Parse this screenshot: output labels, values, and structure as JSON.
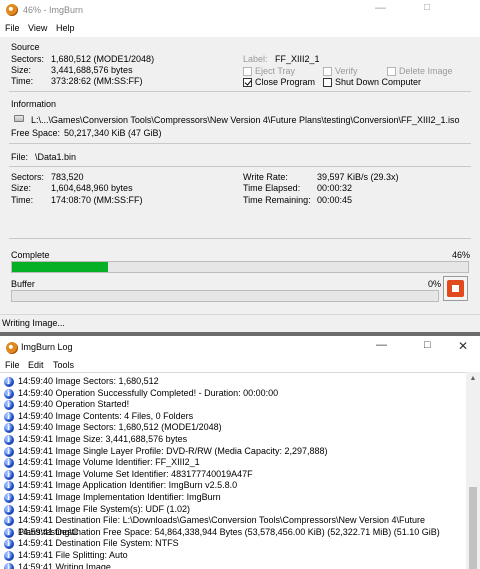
{
  "main_window": {
    "title": "46% - ImgBurn",
    "menu": [
      "File",
      "View",
      "Help"
    ],
    "source": {
      "group_title": "Source",
      "sectors_label": "Sectors:",
      "sectors_value": "1,680,512 (MODE1/2048)",
      "size_label": "Size:",
      "size_value": "3,441,688,576 bytes",
      "time_label": "Time:",
      "time_value": "373:28:62 (MM:SS:FF)",
      "label_label": "Label:",
      "label_value": "FF_XIII2_1",
      "eject_tray": "Eject Tray",
      "verify": "Verify",
      "delete_image": "Delete Image",
      "close_program": "Close Program",
      "shut_down": "Shut Down Computer"
    },
    "information": {
      "group_title": "Information",
      "path": "L:\\...\\Games\\Conversion Tools\\Compressors\\New Version 4\\Future Plans\\testing\\Conversion\\FF_XIII2_1.iso",
      "free_space_label": "Free Space:",
      "free_space_value": "50,217,340 KiB  (47 GiB)",
      "file_label": "File:",
      "file_value": "\\Data1.bin",
      "sectors_label": "Sectors:",
      "sectors_value": "783,520",
      "size_label": "Size:",
      "size_value": "1,604,648,960 bytes",
      "time_label": "Time:",
      "time_value": "174:08:70 (MM:SS:FF)",
      "write_rate_label": "Write Rate:",
      "write_rate_value": "39,597 KiB/s (29.3x)",
      "elapsed_label": "Time Elapsed:",
      "elapsed_value": "00:00:32",
      "remaining_label": "Time Remaining:",
      "remaining_value": "00:00:45"
    },
    "complete_label": "Complete",
    "complete_percent_text": "46%",
    "complete_fraction": 0.46,
    "buffer_label": "Buffer",
    "buffer_percent_text": "0%",
    "buffer_fraction": 0,
    "status": "Writing Image..."
  },
  "log_window": {
    "title": "ImgBurn Log",
    "menu": [
      "File",
      "Edit",
      "Tools"
    ],
    "entries": [
      "14:59:40 Image Sectors: 1,680,512",
      "14:59:40 Operation Successfully Completed! - Duration: 00:00:00",
      "14:59:40 Operation Started!",
      "14:59:40 Image Contents: 4 Files, 0 Folders",
      "14:59:40 Image Sectors: 1,680,512 (MODE1/2048)",
      "14:59:41 Image Size: 3,441,688,576 bytes",
      "14:59:41 Image Single Layer Profile: DVD-R/RW (Media Capacity: 2,297,888)",
      "14:59:41 Image Volume Identifier: FF_XIII2_1",
      "14:59:41 Image Volume Set Identifier: 483177740019A47F",
      "14:59:41 Image Application Identifier: ImgBurn v2.5.8.0",
      "14:59:41 Image Implementation Identifier: ImgBurn",
      "14:59:41 Image File System(s): UDF (1.02)",
      "14:59:41 Destination File: L:\\Downloads\\Games\\Conversion Tools\\Compressors\\New Version 4\\Future Plans\\testing\\C",
      "14:59:41 Destination Free Space: 54,864,338,944 Bytes (53,578,456.00 KiB) (52,322.71 MiB) (51.10 GiB)",
      "14:59:41 Destination File System: NTFS",
      "14:59:41 File Splitting: Auto",
      "14:59:41 Writing Image..."
    ]
  },
  "icons": {
    "app": "imgburn-disc-icon",
    "log_entry": "info-icon",
    "stop": "stop-icon"
  },
  "colors": {
    "progress": "#06b025",
    "stop_button": "#e04a1c",
    "info_icon": "#2350c9"
  }
}
